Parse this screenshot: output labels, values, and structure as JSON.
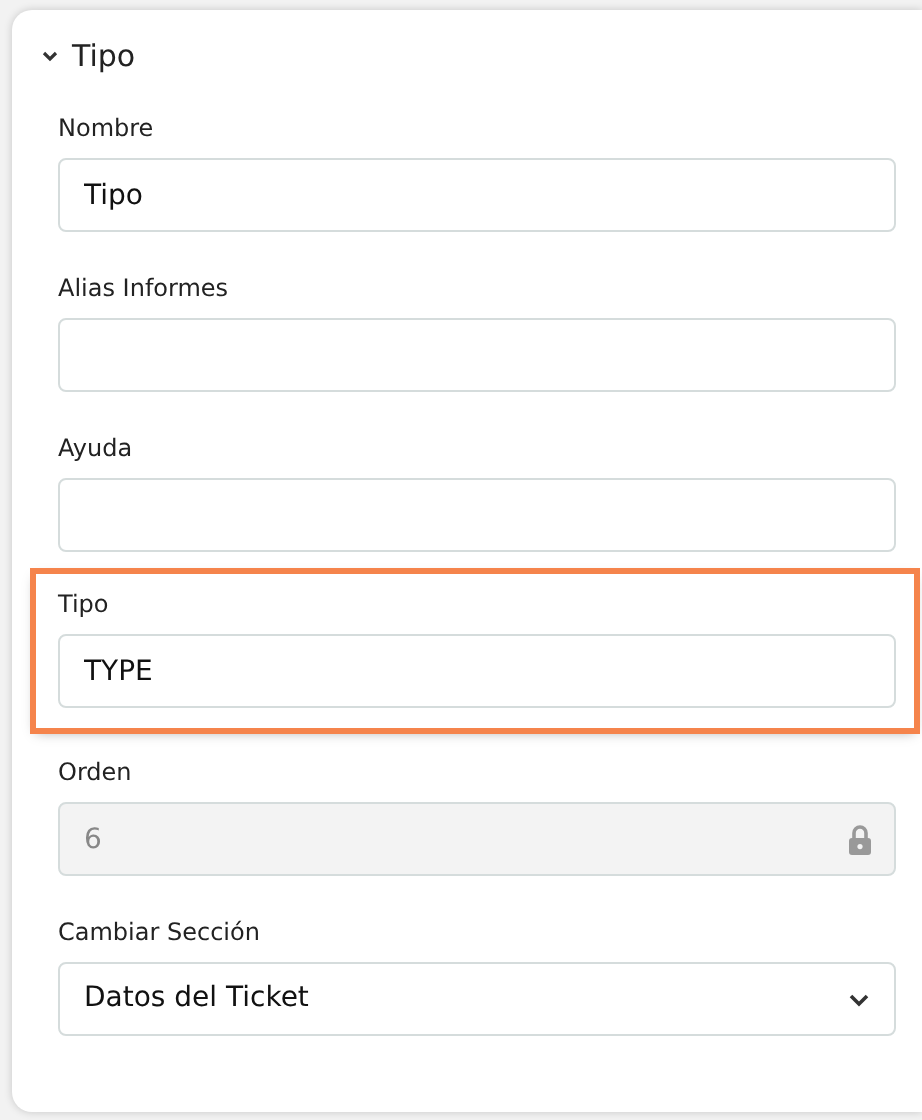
{
  "section": {
    "title": "Tipo",
    "expanded": true
  },
  "fields": [
    {
      "label": "Nombre",
      "kind": "text",
      "value": "Tipo",
      "highlighted": false
    },
    {
      "label": "Alias Informes",
      "kind": "text",
      "highlighted": false
    },
    {
      "label": "Ayuda",
      "kind": "text",
      "highlighted": false
    },
    {
      "label": "Tipo",
      "kind": "text",
      "value": "TYPE",
      "highlighted": true
    },
    {
      "label": "Orden",
      "kind": "locked",
      "value": "6",
      "highlighted": false
    },
    {
      "label": "Cambiar Sección",
      "kind": "select",
      "value": "Datos del Ticket",
      "highlighted": false
    }
  ]
}
